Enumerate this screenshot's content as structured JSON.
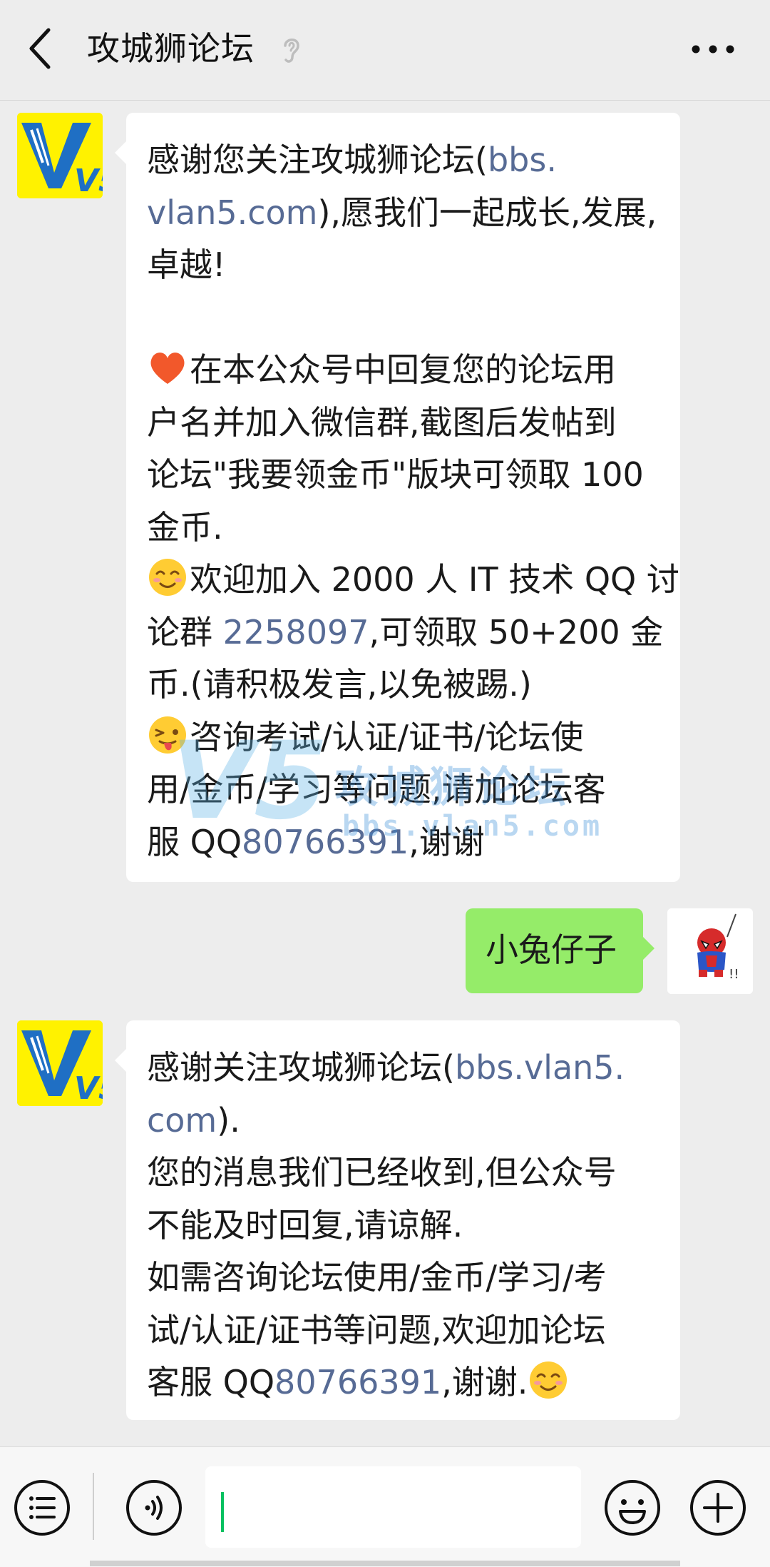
{
  "header": {
    "title": "攻城狮论坛",
    "back_icon": "chevron-left-icon",
    "ear_icon": "ear-icon",
    "more_icon": "more-dots-icon"
  },
  "avatars": {
    "official_text": "V5",
    "colors": {
      "official_bg": "#fff200",
      "official_fg": "#1f6fc4"
    }
  },
  "messages": [
    {
      "from": "official",
      "lines": [
        [
          {
            "t": "感谢您关注攻城狮论坛("
          },
          {
            "t": "bbs.",
            "link": true
          }
        ],
        [
          {
            "t": "vlan5.com",
            "link": true
          },
          {
            "t": "),愿我们一起成长,发展,"
          }
        ],
        [
          {
            "t": "卓越!"
          }
        ],
        [
          {
            "t": ""
          }
        ],
        [
          {
            "emoji": "heart-emoji"
          },
          {
            "t": "在本公众号中回复您的论坛用"
          }
        ],
        [
          {
            "t": "户名并加入微信群,截图后发帖到"
          }
        ],
        [
          {
            "t": "论坛\"我要领金币\"版块可领取 100"
          }
        ],
        [
          {
            "t": "金币."
          }
        ],
        [
          {
            "emoji": "smile-emoji"
          },
          {
            "t": "欢迎加入 2000 人 IT 技术 QQ 讨"
          }
        ],
        [
          {
            "t": "论群 "
          },
          {
            "t": "2258097",
            "link": true
          },
          {
            "t": ",可领取 50+200 金"
          }
        ],
        [
          {
            "t": "币.(请积极发言,以免被踢.)"
          }
        ],
        [
          {
            "emoji": "wink-tongue-emoji"
          },
          {
            "t": "咨询考试/认证/证书/论坛使"
          }
        ],
        [
          {
            "t": "用/金币/学习等问题,请加论坛客"
          }
        ],
        [
          {
            "t": "服 QQ"
          },
          {
            "t": "80766391",
            "link": true
          },
          {
            "t": ",谢谢"
          }
        ]
      ]
    },
    {
      "from": "me",
      "lines": [
        [
          {
            "t": "小兔仔子"
          }
        ]
      ]
    },
    {
      "from": "official",
      "lines": [
        [
          {
            "t": "感谢关注攻城狮论坛("
          },
          {
            "t": "bbs.vlan5.",
            "link": true
          }
        ],
        [
          {
            "t": "com",
            "link": true
          },
          {
            "t": ")."
          }
        ],
        [
          {
            "t": "您的消息我们已经收到,但公众号"
          }
        ],
        [
          {
            "t": "不能及时回复,请谅解."
          }
        ],
        [
          {
            "t": "如需咨询论坛使用/金币/学习/考"
          }
        ],
        [
          {
            "t": "试/认证/证书等问题,欢迎加论坛"
          }
        ],
        [
          {
            "t": "客服 QQ"
          },
          {
            "t": "80766391",
            "link": true
          },
          {
            "t": ",谢谢."
          },
          {
            "emoji": "smile-emoji"
          }
        ]
      ]
    }
  ],
  "watermark": {
    "logo": "V5",
    "cn": "攻城狮论坛",
    "url": "bbs.vlan5.com"
  },
  "input_bar": {
    "menu_icon": "list-menu-icon",
    "voice_icon": "voice-icon",
    "input_value": "",
    "emoji_icon": "emoji-face-icon",
    "plus_icon": "plus-circle-icon"
  },
  "colors": {
    "background": "#ededed",
    "bubble_in": "#ffffff",
    "bubble_out": "#95ec69",
    "link": "#576b95",
    "cursor": "#07c160"
  }
}
